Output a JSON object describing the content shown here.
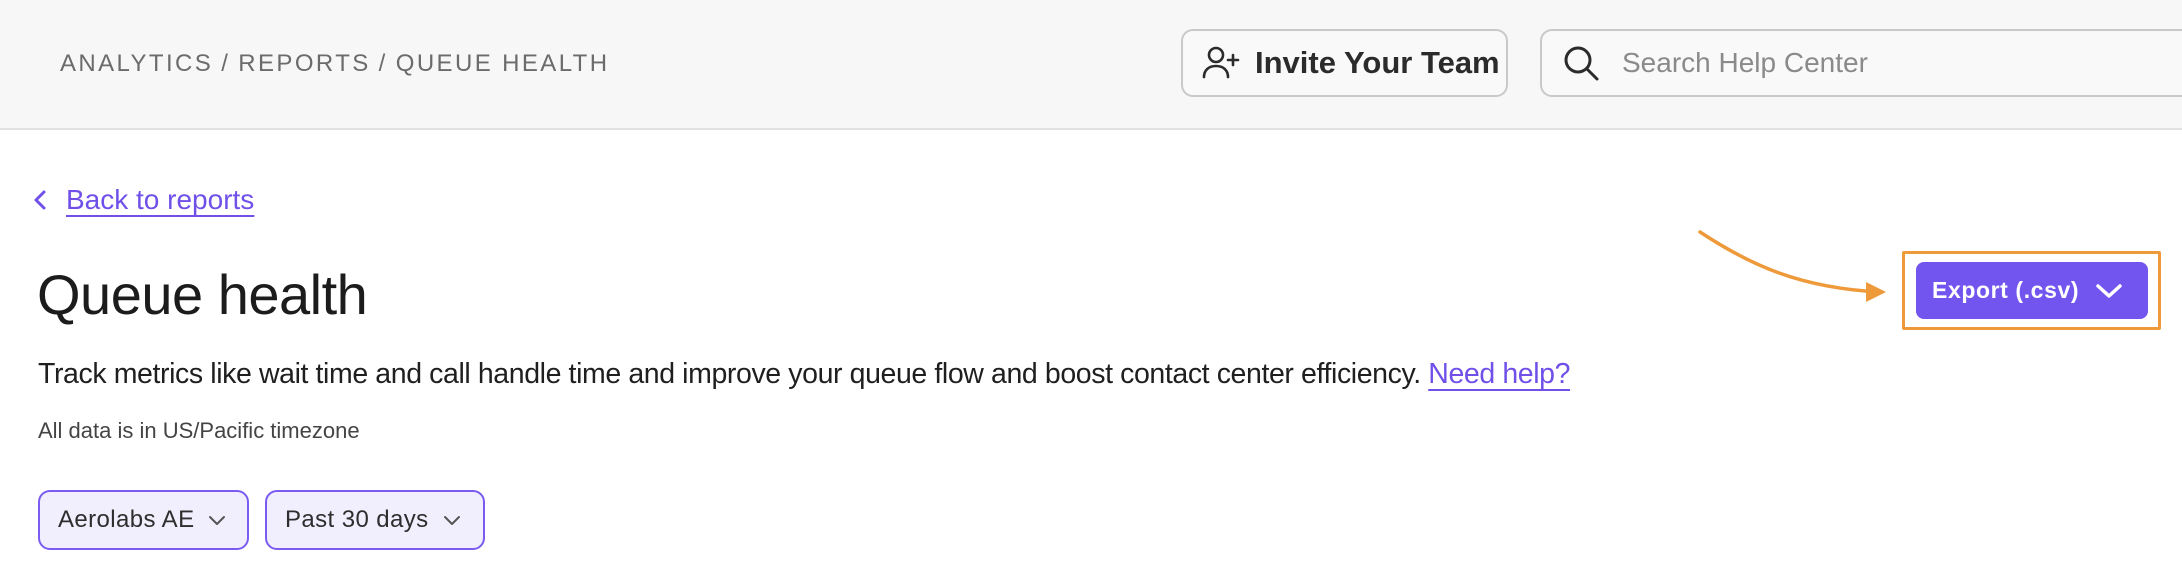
{
  "header": {
    "breadcrumb": {
      "items": [
        "ANALYTICS",
        "REPORTS",
        "QUEUE HEALTH"
      ],
      "separator": "/"
    },
    "invite_button": {
      "label": "Invite Your Team",
      "icon": "user-plus-icon"
    },
    "search": {
      "placeholder": "Search Help Center",
      "value": "",
      "icon": "search-icon"
    }
  },
  "main": {
    "back_link": {
      "label": "Back to reports",
      "icon": "chevron-left-icon"
    },
    "title": "Queue health",
    "description": "Track metrics like wait time and call handle time and improve your queue flow and boost contact center efficiency.",
    "help_link": "Need help?",
    "timezone_note": "All data is in US/Pacific timezone",
    "filters": [
      {
        "label": "Aerolabs AE",
        "icon": "chevron-down-icon"
      },
      {
        "label": "Past 30 days",
        "icon": "chevron-down-icon"
      }
    ],
    "export_button": {
      "label": "Export (.csv)",
      "icon": "chevron-down-icon"
    }
  },
  "colors": {
    "accent": "#7255ee",
    "link": "#7050e8",
    "highlight": "#ee9a3a",
    "header_bg": "#f7f7f7"
  }
}
